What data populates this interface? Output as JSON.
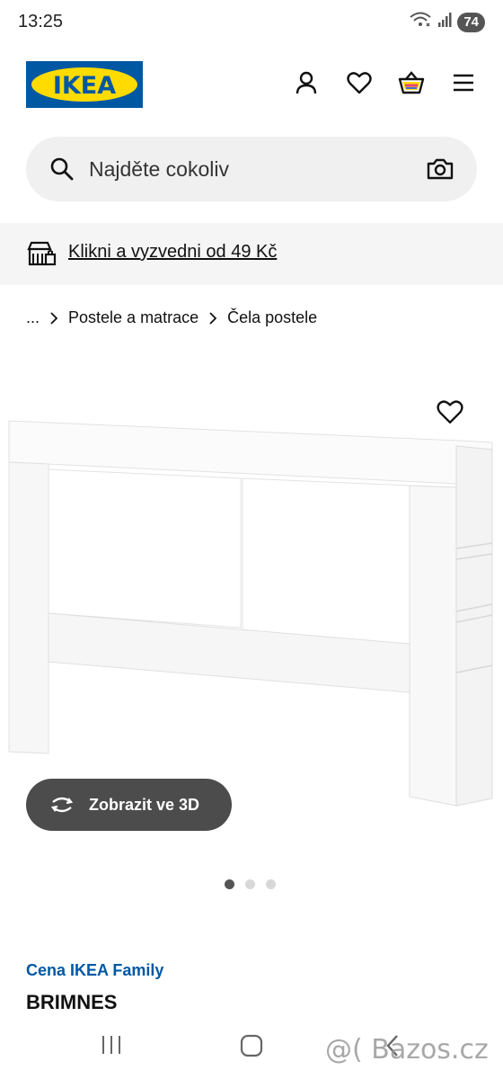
{
  "status": {
    "time": "13:25",
    "battery": "74"
  },
  "header": {
    "logo_text": "IKEA"
  },
  "search": {
    "placeholder": "Najděte cokoliv"
  },
  "promo": {
    "link_text": "Klikni a vyzvedni od 49 Kč"
  },
  "breadcrumb": {
    "items": [
      "...",
      "Postele a matrace",
      "Čela postele"
    ]
  },
  "gallery": {
    "view3d_label": "Zobrazit ve 3D",
    "slide_count": 3,
    "active_slide": 1
  },
  "product": {
    "family_price_label": "Cena IKEA Family",
    "name": "BRIMNES"
  },
  "watermark": {
    "text": "@( Bazos.cz"
  },
  "colors": {
    "ikea_blue": "#0058a3",
    "ikea_yellow": "#ffdb00",
    "button_dark": "#4c4c4c",
    "promo_bg": "#f5f5f5"
  },
  "icons": [
    "wifi-icon",
    "signal-icon",
    "user-icon",
    "heart-icon",
    "basket-icon",
    "menu-icon",
    "search-icon",
    "camera-icon",
    "store-pickup-icon",
    "chevron-right-icon",
    "rotate-3d-icon"
  ]
}
